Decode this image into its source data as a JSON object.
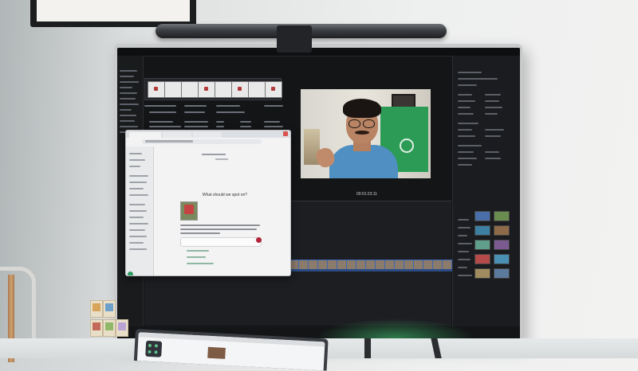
{
  "scene": {
    "description_type": "photo of a desk setup with an external monitor displaying video editing software and a browser window",
    "palette": {
      "wall": "#e2e4e4",
      "monitor_bezel": "#c9cbcc",
      "screen_bg": "#141517",
      "accent_green": "#2f9e63",
      "accent_red": "#b3243b",
      "timeline_blue": "#3a66b5",
      "neon_glow": "#46d278"
    }
  },
  "monitor": {
    "editor": {
      "timecode": "00:01:23:11"
    },
    "browser": {
      "prompt_heading": "What should we spot on?"
    }
  }
}
